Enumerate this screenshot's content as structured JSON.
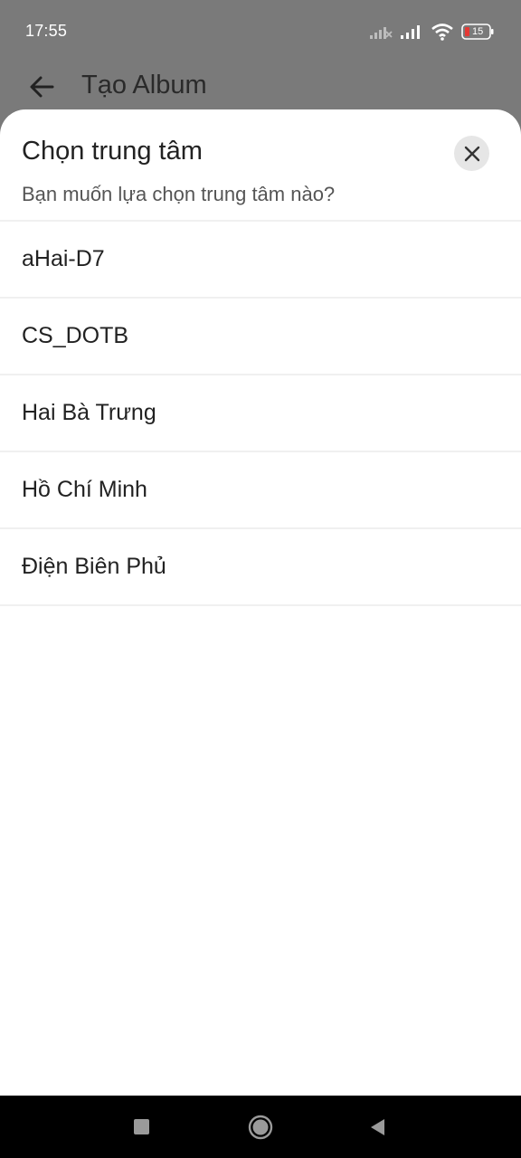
{
  "status_bar": {
    "time": "17:55",
    "battery_level": "15",
    "icons": [
      "signal-no-service-icon",
      "cell-signal-icon",
      "wifi-icon",
      "battery-icon"
    ]
  },
  "app_bar": {
    "title": "Tạo Album",
    "back_icon": "arrow-left-icon"
  },
  "sheet": {
    "title": "Chọn trung tâm",
    "subtitle": "Bạn muốn lựa chọn trung tâm nào?",
    "close_icon": "close-icon",
    "options": [
      {
        "label": "aHai-D7"
      },
      {
        "label": "CS_DOTB"
      },
      {
        "label": "Hai Bà Trưng"
      },
      {
        "label": "Hồ Chí Minh"
      },
      {
        "label": "Điện Biên Phủ"
      }
    ]
  },
  "nav_bar": {
    "icons": [
      "recents-square-icon",
      "home-circle-icon",
      "back-triangle-icon"
    ]
  },
  "colors": {
    "scrim": "#7a7a7a",
    "sheet_background": "#ffffff",
    "divider": "#f0f0f0",
    "close_button_bg": "#e6e6e6",
    "battery_low": "#e53935"
  }
}
